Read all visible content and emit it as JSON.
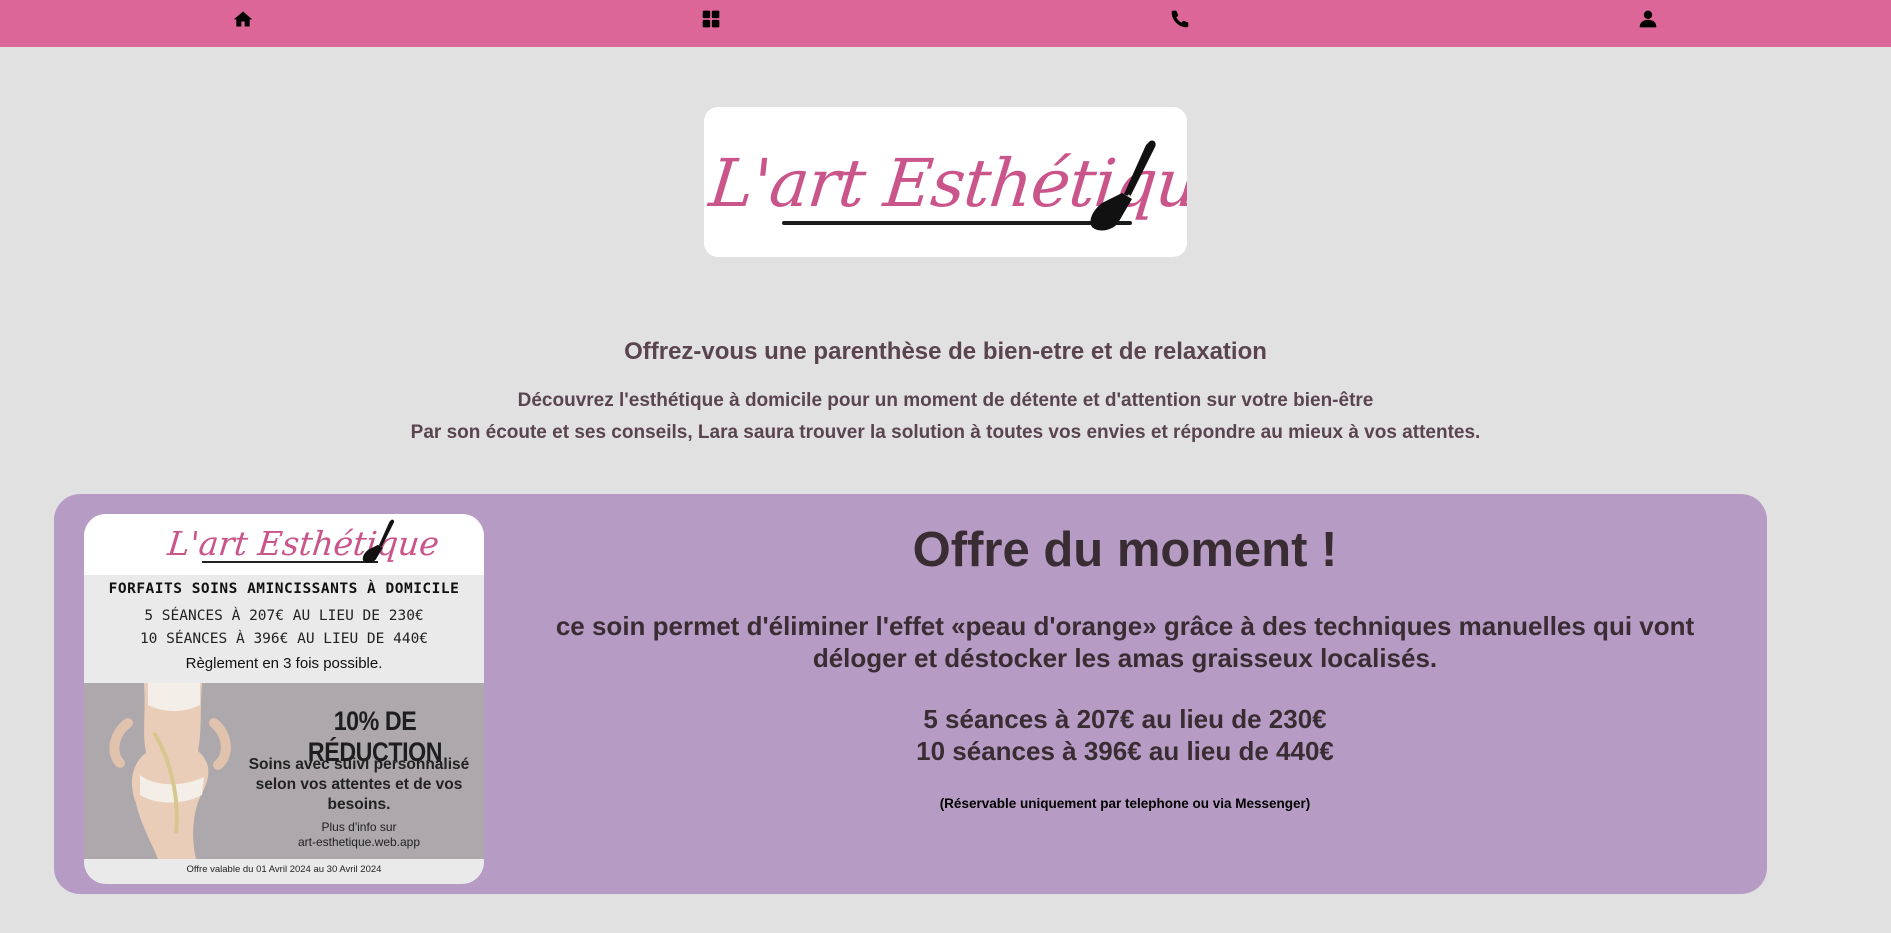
{
  "nav": {
    "icons": [
      "home-icon",
      "grid-icon",
      "phone-icon",
      "user-icon"
    ]
  },
  "logo": {
    "text": "L'art Esthétique",
    "brand_color": "#c9558a"
  },
  "intro": {
    "title": "Offrez-vous une parenthèse de bien-etre et de relaxation",
    "line1": "Découvrez l'esthétique à domicile pour un moment de détente et d'attention sur votre bien-être",
    "line2": "Par son écoute et ses conseils, Lara saura trouver la solution à toutes vos envies et répondre au mieux à vos attentes."
  },
  "flyer": {
    "logo_text": "L'art Esthétique",
    "forfaits": "FORFAITS SOINS AMINCISSANTS À DOMICILE",
    "offer_line1": "5 SÉANCES À 207€ AU LIEU DE 230€",
    "offer_line2": "10 SÉANCES À 396€ AU LIEU DE 440€",
    "reglement": "Règlement en 3 fois possible.",
    "reduction": "10% DE RÉDUCTION",
    "soins": "Soins avec suivi personnalisé selon vos attentes et de vos besoins.",
    "info_label": "Plus d'info sur",
    "info_url": "art-esthetique.web.app",
    "footer": "Offre valable du 01 Avril 2024 au 30 Avril 2024"
  },
  "offer": {
    "title": "Offre du moment !",
    "description": "ce soin permet d'éliminer l'effet «peau d'orange» grâce à des techniques manuelles qui vont déloger et déstocker les amas graisseux localisés.",
    "price1": "5 séances à 207€ au lieu de 230€",
    "price2": "10 séances à 396€ au lieu de 440€",
    "note": "(Réservable uniquement par telephone ou via Messenger)"
  },
  "colors": {
    "nav_bg": "#dd6699",
    "page_bg": "#e1e1e1",
    "panel_bg": "#b69cc4",
    "text_dark": "#3a2c33"
  }
}
